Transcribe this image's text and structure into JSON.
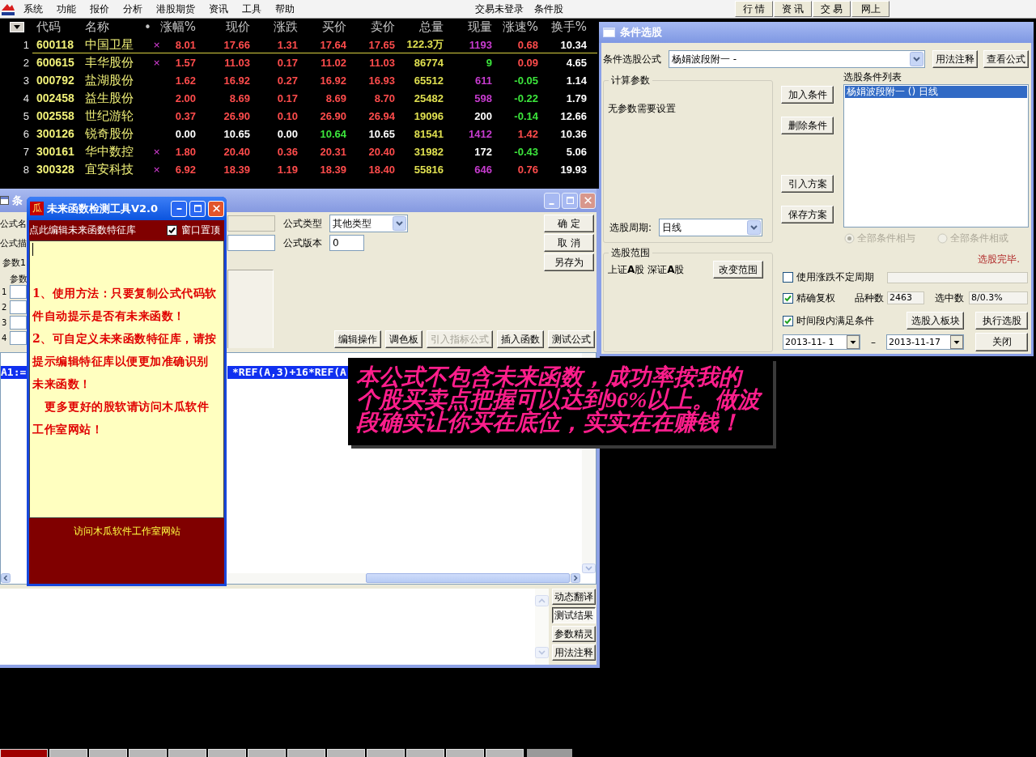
{
  "menu_bar": {
    "items": [
      "系统",
      "功能",
      "报价",
      "分析",
      "港股期货",
      "资讯",
      "工具",
      "帮助"
    ],
    "status": [
      "交易未登录",
      "条件股"
    ],
    "buttons": [
      "行 情",
      "资 讯",
      "交 易",
      "网上"
    ]
  },
  "quote_table": {
    "columns": [
      "",
      "代码",
      "名称",
      "•",
      "涨幅%",
      "现价",
      "涨跌",
      "买价",
      "卖价",
      "总量",
      "现量",
      "涨速%",
      "换手%"
    ],
    "rows": [
      {
        "selected": true,
        "cells": [
          {
            "text": "1"
          },
          {
            "text": "600118"
          },
          {
            "text": "中国卫星"
          },
          {
            "text": "×"
          },
          {
            "text": "8.01",
            "color": "#ff4c4c"
          },
          {
            "text": "17.66",
            "color": "#ff4c4c"
          },
          {
            "text": "1.31",
            "color": "#ff4c4c"
          },
          {
            "text": "17.64",
            "color": "#ff4c4c"
          },
          {
            "text": "17.65",
            "color": "#ff4c4c"
          },
          {
            "text": "122.3万",
            "color": "#e0e050"
          },
          {
            "text": "1193",
            "color": "#c83cd0"
          },
          {
            "text": "0.68",
            "color": "#ff4c4c"
          },
          {
            "text": "10.34",
            "color": "#ffffff"
          }
        ]
      },
      {
        "selected": false,
        "cells": [
          {
            "text": "2"
          },
          {
            "text": "600615"
          },
          {
            "text": "丰华股份"
          },
          {
            "text": "×"
          },
          {
            "text": "1.57",
            "color": "#ff4c4c"
          },
          {
            "text": "11.03",
            "color": "#ff4c4c"
          },
          {
            "text": "0.17",
            "color": "#ff4c4c"
          },
          {
            "text": "11.02",
            "color": "#ff4c4c"
          },
          {
            "text": "11.03",
            "color": "#ff4c4c"
          },
          {
            "text": "86774",
            "color": "#e0e050"
          },
          {
            "text": "9",
            "color": "#3ce63c"
          },
          {
            "text": "0.09",
            "color": "#ff4c4c"
          },
          {
            "text": "4.65",
            "color": "#ffffff"
          }
        ]
      },
      {
        "selected": false,
        "cells": [
          {
            "text": "3"
          },
          {
            "text": "000792"
          },
          {
            "text": "盐湖股份"
          },
          {
            "text": ""
          },
          {
            "text": "1.62",
            "color": "#ff4c4c"
          },
          {
            "text": "16.92",
            "color": "#ff4c4c"
          },
          {
            "text": "0.27",
            "color": "#ff4c4c"
          },
          {
            "text": "16.92",
            "color": "#ff4c4c"
          },
          {
            "text": "16.93",
            "color": "#ff4c4c"
          },
          {
            "text": "65512",
            "color": "#e0e050"
          },
          {
            "text": "611",
            "color": "#c83cd0"
          },
          {
            "text": "-0.05",
            "color": "#3ce63c"
          },
          {
            "text": "1.14",
            "color": "#ffffff"
          }
        ]
      },
      {
        "selected": false,
        "cells": [
          {
            "text": "4"
          },
          {
            "text": "002458"
          },
          {
            "text": "益生股份"
          },
          {
            "text": ""
          },
          {
            "text": "2.00",
            "color": "#ff4c4c"
          },
          {
            "text": "8.69",
            "color": "#ff4c4c"
          },
          {
            "text": "0.17",
            "color": "#ff4c4c"
          },
          {
            "text": "8.69",
            "color": "#ff4c4c"
          },
          {
            "text": "8.70",
            "color": "#ff4c4c"
          },
          {
            "text": "25482",
            "color": "#e0e050"
          },
          {
            "text": "598",
            "color": "#c83cd0"
          },
          {
            "text": "-0.22",
            "color": "#3ce63c"
          },
          {
            "text": "1.79",
            "color": "#ffffff"
          }
        ]
      },
      {
        "selected": false,
        "cells": [
          {
            "text": "5"
          },
          {
            "text": "002558"
          },
          {
            "text": "世纪游轮"
          },
          {
            "text": ""
          },
          {
            "text": "0.37",
            "color": "#ff4c4c"
          },
          {
            "text": "26.90",
            "color": "#ff4c4c"
          },
          {
            "text": "0.10",
            "color": "#ff4c4c"
          },
          {
            "text": "26.90",
            "color": "#ff4c4c"
          },
          {
            "text": "26.94",
            "color": "#ff4c4c"
          },
          {
            "text": "19096",
            "color": "#e0e050"
          },
          {
            "text": "200",
            "color": "#ffffff"
          },
          {
            "text": "-0.14",
            "color": "#3ce63c"
          },
          {
            "text": "12.66",
            "color": "#ffffff"
          }
        ]
      },
      {
        "selected": false,
        "cells": [
          {
            "text": "6"
          },
          {
            "text": "300126"
          },
          {
            "text": "锐奇股份"
          },
          {
            "text": ""
          },
          {
            "text": "0.00",
            "color": "#ffffff"
          },
          {
            "text": "10.65",
            "color": "#ffffff"
          },
          {
            "text": "0.00",
            "color": "#ffffff"
          },
          {
            "text": "10.64",
            "color": "#3ce63c"
          },
          {
            "text": "10.65",
            "color": "#ffffff"
          },
          {
            "text": "81541",
            "color": "#e0e050"
          },
          {
            "text": "1412",
            "color": "#c83cd0"
          },
          {
            "text": "1.42",
            "color": "#ff4c4c"
          },
          {
            "text": "10.36",
            "color": "#ffffff"
          }
        ]
      },
      {
        "selected": false,
        "cells": [
          {
            "text": "7"
          },
          {
            "text": "300161"
          },
          {
            "text": "华中数控"
          },
          {
            "text": "×"
          },
          {
            "text": "1.80",
            "color": "#ff4c4c"
          },
          {
            "text": "20.40",
            "color": "#ff4c4c"
          },
          {
            "text": "0.36",
            "color": "#ff4c4c"
          },
          {
            "text": "20.31",
            "color": "#ff4c4c"
          },
          {
            "text": "20.40",
            "color": "#ff4c4c"
          },
          {
            "text": "31982",
            "color": "#e0e050"
          },
          {
            "text": "172",
            "color": "#ffffff"
          },
          {
            "text": "-0.43",
            "color": "#3ce63c"
          },
          {
            "text": "5.06",
            "color": "#ffffff"
          }
        ]
      },
      {
        "selected": false,
        "cells": [
          {
            "text": "8"
          },
          {
            "text": "300328"
          },
          {
            "text": "宜安科技"
          },
          {
            "text": "×"
          },
          {
            "text": "6.92",
            "color": "#ff4c4c"
          },
          {
            "text": "18.39",
            "color": "#ff4c4c"
          },
          {
            "text": "1.19",
            "color": "#ff4c4c"
          },
          {
            "text": "18.39",
            "color": "#ff4c4c"
          },
          {
            "text": "18.40",
            "color": "#ff4c4c"
          },
          {
            "text": "55816",
            "color": "#e0e050"
          },
          {
            "text": "646",
            "color": "#c83cd0"
          },
          {
            "text": "0.76",
            "color": "#ff4c4c"
          },
          {
            "text": "19.93",
            "color": "#ffffff"
          }
        ]
      }
    ]
  },
  "formula_editor": {
    "title": "条",
    "name_label": "公式名",
    "desc_label": "公式描",
    "param_label": "参数1",
    "param_header": "参数",
    "param_rows": [
      "1",
      "2",
      "3",
      "4"
    ],
    "type_label": "公式类型",
    "type": "其他类型",
    "version_label": "公式版本",
    "version": "0",
    "side_buttons": [
      "确 定",
      "取 消",
      "另存为"
    ],
    "tool_buttons": [
      {
        "label": "编辑操作",
        "disabled": false
      },
      {
        "label": "调色板",
        "disabled": false
      },
      {
        "label": "引入指标公式",
        "disabled": true
      },
      {
        "label": "插入函数",
        "disabled": false
      },
      {
        "label": "测试公式",
        "disabled": false
      }
    ],
    "code_fragments": [
      "A1:=",
      "*REF(A,3)+16*REF(A"
    ],
    "result_tabs": [
      {
        "label": "动态翻译",
        "selected": false
      },
      {
        "label": "测试结果",
        "selected": true
      },
      {
        "label": "参数精灵",
        "selected": false
      },
      {
        "label": "用法注释",
        "selected": false
      }
    ]
  },
  "checker_window": {
    "icon": "瓜",
    "title": "未来函数检测工具V2.0",
    "edit_link": "点此编辑未来函数特征库",
    "pin": {
      "label": "窗口置顶",
      "checked": true
    },
    "notes": [
      "1、使用方法：只要复制公式代码软件自动提示是否有未来函数！",
      "2、可自定义未来函数特征库，请按提示编辑特征库以便更加准确识别未来函数！",
      "更多更好的股软请访问木瓜软件工作室网站！"
    ],
    "footer_link": "访问木瓜软件工作室网站"
  },
  "promo_note": {
    "text": "本公式不包含未来函数，成功率按我的个股买卖点把握可以达到96%以上。做波段确实让你买在底位，实实在在赚钱！"
  },
  "stock_picker": {
    "title": "条件选股",
    "formula_label": "条件选股公式",
    "formula": "杨娟波段附一 -",
    "top_buttons": [
      "用法注释",
      "查看公式"
    ],
    "params_group": "计算参数",
    "params_note": "无参数需要设置",
    "period_label": "选股周期:",
    "period": "日线",
    "action_buttons": [
      "加入条件",
      "删除条件",
      "引入方案",
      "保存方案"
    ],
    "list_label": "选股条件列表",
    "conditions": [
      {
        "text": "杨娟波段附一 () 日线",
        "selected": true
      }
    ],
    "logic": [
      {
        "label": "全部条件相与",
        "selected": true,
        "disabled": true
      },
      {
        "label": "全部条件相或",
        "selected": false,
        "disabled": true
      }
    ],
    "status": "选股完毕.",
    "range_group": "选股范围",
    "range": "上证**A**股 深证**A**股",
    "range_button": "改变范围",
    "options": [
      {
        "label": "使用涨跌不定周期",
        "checked": false
      },
      {
        "label": "精确复权",
        "checked": true
      },
      {
        "label": "时间段内满足条件",
        "checked": true
      }
    ],
    "count_label": "品种数",
    "count": "2463",
    "hit_label": "选中数",
    "hit": "8/0.3%",
    "run_buttons": [
      "选股入板块",
      "执行选股"
    ],
    "date_from": "2013-11- 1",
    "date_sep": "–",
    "date_to": "2013-11-17",
    "close_button": "关闭"
  },
  "sheet_tabs": [
    {
      "selected": true
    },
    {
      "selected": false
    },
    {
      "selected": false
    },
    {
      "selected": false
    },
    {
      "selected": false
    },
    {
      "selected": false
    },
    {
      "selected": false
    },
    {
      "selected": false
    },
    {
      "selected": false
    },
    {
      "selected": false
    },
    {
      "selected": false
    },
    {
      "selected": false
    },
    {
      "selected": false
    }
  ]
}
